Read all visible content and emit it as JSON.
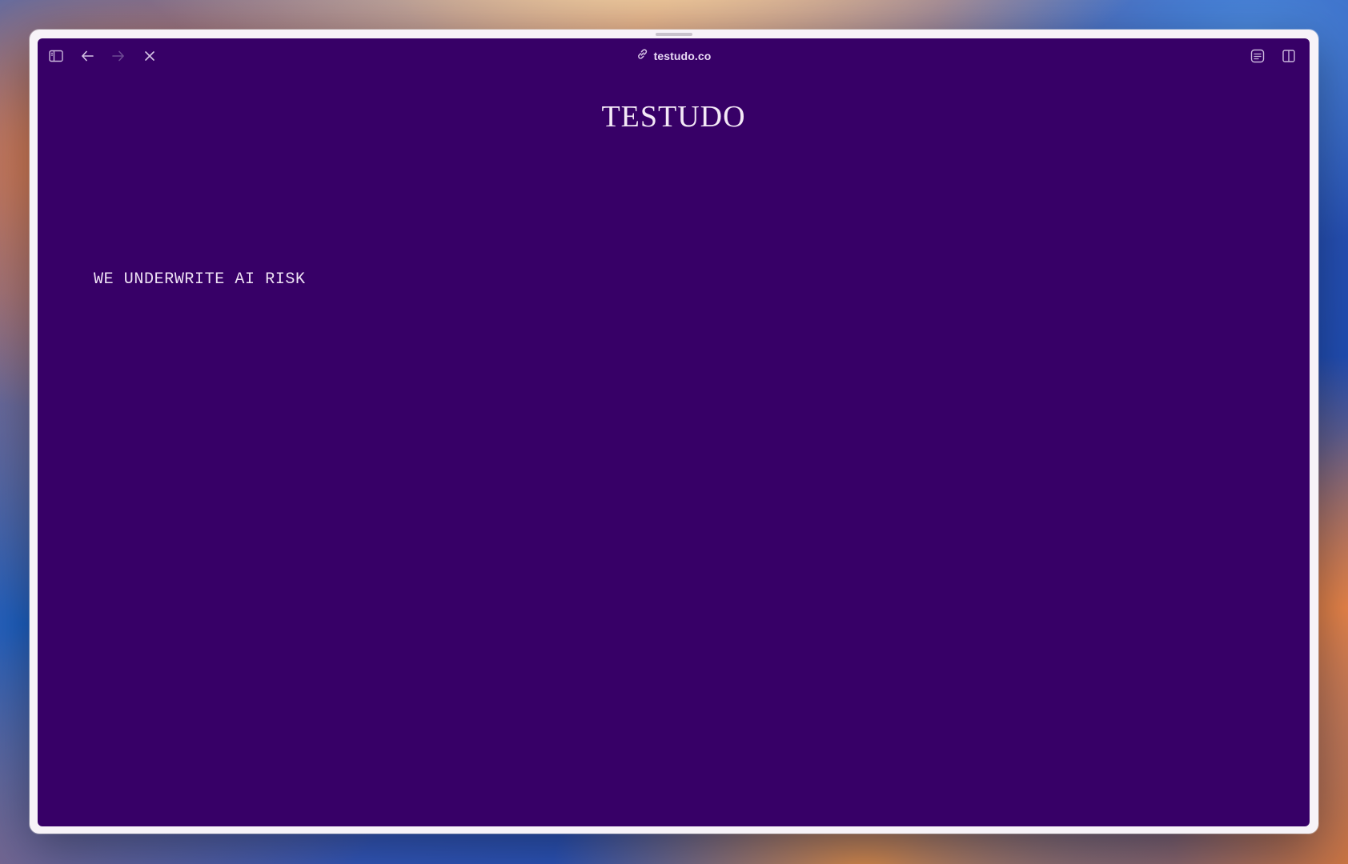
{
  "browser": {
    "url": "testudo.co",
    "icons": {
      "sidebar": "sidebar-icon",
      "back": "back-arrow-icon",
      "forward": "forward-arrow-icon",
      "stop": "close-icon",
      "link": "link-icon",
      "reader": "reader-mode-icon",
      "split": "split-view-icon"
    },
    "forward_enabled": false
  },
  "page": {
    "title": "TESTUDO",
    "tagline": "WE UNDERWRITE AI RISK",
    "background_color": "#370067",
    "text_color": "#f4e9f7"
  }
}
